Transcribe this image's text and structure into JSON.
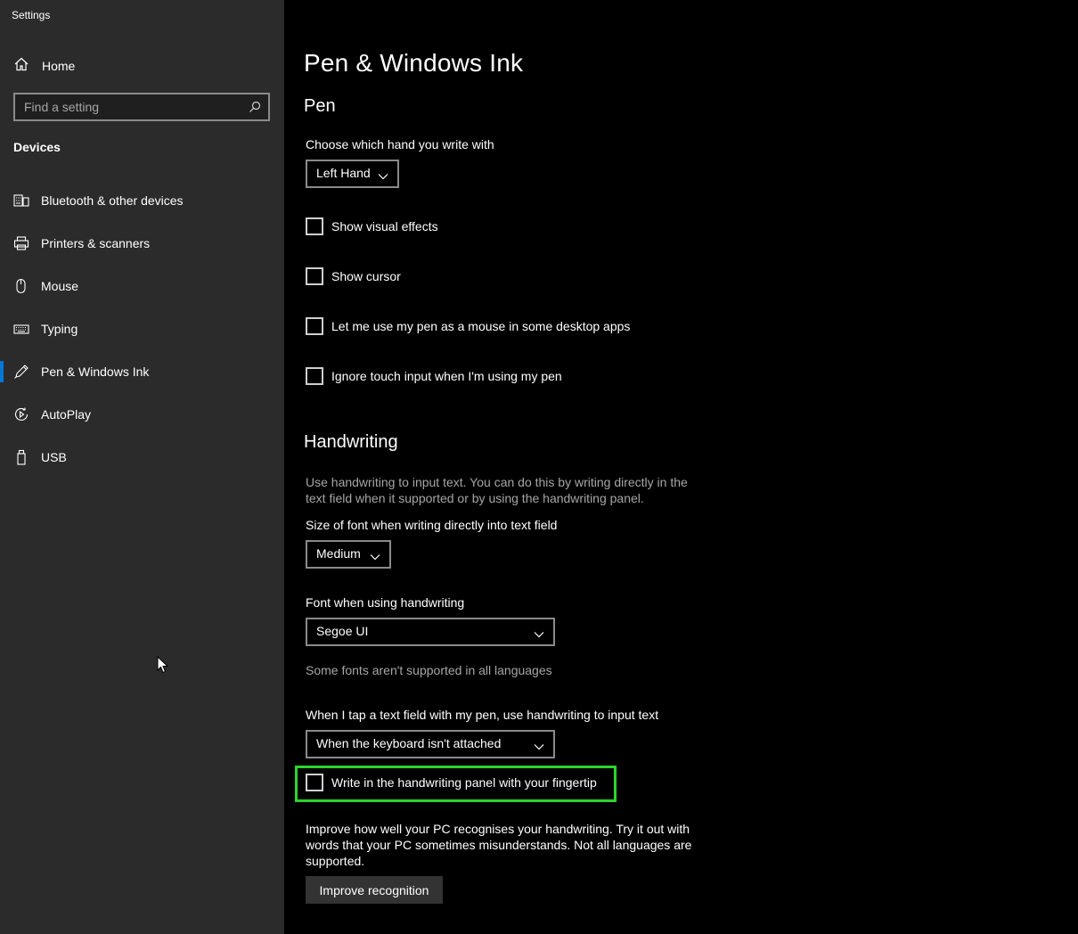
{
  "window": {
    "title": "Settings"
  },
  "sidebar": {
    "home_label": "Home",
    "search": {
      "placeholder": "Find a setting",
      "value": ""
    },
    "section_heading": "Devices",
    "items": [
      {
        "label": "Bluetooth & other devices",
        "icon": "bluetooth-devices-icon",
        "active": false
      },
      {
        "label": "Printers & scanners",
        "icon": "printer-icon",
        "active": false
      },
      {
        "label": "Mouse",
        "icon": "mouse-icon",
        "active": false
      },
      {
        "label": "Typing",
        "icon": "keyboard-icon",
        "active": false
      },
      {
        "label": "Pen & Windows Ink",
        "icon": "pen-icon",
        "active": true
      },
      {
        "label": "AutoPlay",
        "icon": "autoplay-icon",
        "active": false
      },
      {
        "label": "USB",
        "icon": "usb-icon",
        "active": false
      }
    ]
  },
  "main": {
    "title": "Pen & Windows Ink",
    "pen": {
      "heading": "Pen",
      "hand_label": "Choose which hand you write with",
      "hand_value": "Left Hand",
      "checkboxes": [
        {
          "label": "Show visual effects",
          "checked": false
        },
        {
          "label": "Show cursor",
          "checked": false
        },
        {
          "label": "Let me use my pen as a mouse in some desktop apps",
          "checked": false
        },
        {
          "label": "Ignore touch input when I'm using my pen",
          "checked": false
        }
      ]
    },
    "handwriting": {
      "heading": "Handwriting",
      "description": "Use handwriting to input text. You can do this by writing directly in the text field when it supported or by using the handwriting panel.",
      "font_size_label": "Size of font when writing directly into text field",
      "font_size_value": "Medium",
      "font_label": "Font when using handwriting",
      "font_value": "Segoe UI",
      "font_note": "Some fonts aren't supported in all languages",
      "tap_label": "When I tap a text field with my pen, use handwriting to input text",
      "tap_value": "When the keyboard isn't attached",
      "fingertip_label": "Write in the handwriting panel with your fingertip",
      "fingertip_checked": false,
      "improve_text": "Improve how well your PC recognises your handwriting. Try it out with words that your PC sometimes misunderstands. Not all languages are supported.",
      "improve_button": "Improve recognition"
    }
  },
  "colors": {
    "accent": "#0078d7",
    "highlight": "#2ad52a",
    "sidebar_bg": "#2b2b2b"
  }
}
